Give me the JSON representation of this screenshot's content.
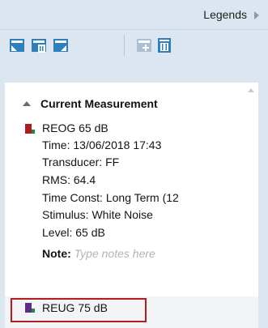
{
  "header": {
    "title": "Legends"
  },
  "toolbar": {
    "icons": [
      "select-all-icon",
      "delete-selected-icon",
      "deselect-icon",
      "add-disabled-icon",
      "trash-icon"
    ]
  },
  "section": {
    "title": "Current Measurement"
  },
  "measurements": [
    {
      "name": "REOG 65 dB",
      "time": "Time: 13/06/2018 17:43",
      "transducer": "Transducer: FF",
      "rms": "RMS: 64.4",
      "time_const": "Time Const: Long Term (12",
      "stimulus": "Stimulus: White Noise",
      "level": "Level: 65 dB",
      "note_label": "Note:",
      "note_placeholder": "Type notes here",
      "flag_color": "#b01c1c",
      "flag_accent": "#1f8a3b"
    },
    {
      "name": "REUG 75 dB",
      "flag_color": "#5b2c8a",
      "flag_accent": "#1f8a3b"
    }
  ],
  "colors": {
    "panel_bg": "#dbe6f1",
    "highlight": "#b31c1c"
  }
}
